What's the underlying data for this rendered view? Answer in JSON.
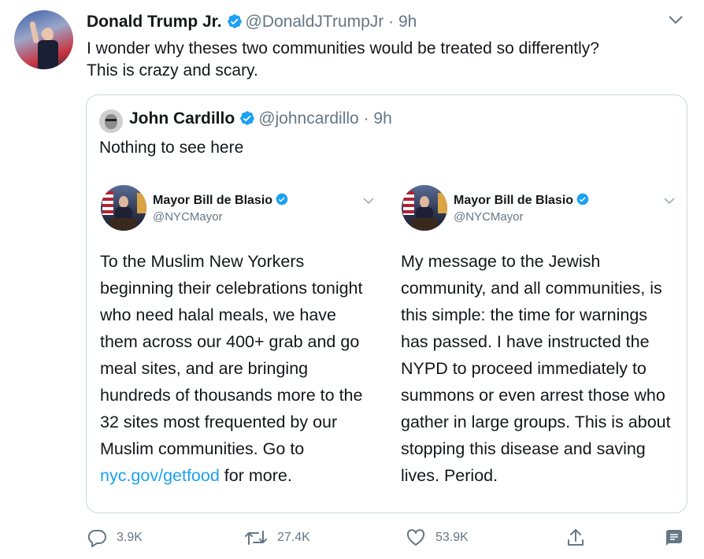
{
  "tweet": {
    "author_name": "Donald Trump Jr.",
    "author_handle": "@DonaldJTrumpJr",
    "separator": " · ",
    "time": "9h",
    "text": "I wonder why theses two communities would be treated so differently?\nThis is crazy and scary."
  },
  "quote": {
    "author_name": "John Cardillo",
    "author_handle": "@johncardillo",
    "separator": " · ",
    "time": "9h",
    "text": "Nothing to see here"
  },
  "embedded": [
    {
      "name": "Mayor Bill de Blasio",
      "handle": "@NYCMayor",
      "text_before_link": "To the Muslim New Yorkers beginning their celebrations tonight who need halal meals, we have them across our 400+ grab and go meal sites, and are bringing hundreds of thousands more to the 32 sites most frequented by our Muslim communities. Go to ",
      "link": "nyc.gov/getfood",
      "text_after_link": " for more."
    },
    {
      "name": "Mayor Bill de Blasio",
      "handle": "@NYCMayor",
      "text": "My message to the Jewish community, and all communities, is this simple: the time for warnings has passed. I have instructed the NYPD to proceed immediately to summons or even arrest those who gather in large groups. This is about stopping this disease and saving lives. Period."
    }
  ],
  "actions": {
    "replies": "3.9K",
    "retweets": "27.4K",
    "likes": "53.9K"
  },
  "colors": {
    "verified": "#1da1f2",
    "link": "#1da1f2",
    "muted": "#657786",
    "border": "#ccd6dd"
  },
  "icons": [
    "verified-icon",
    "chevron-down-icon",
    "reply-icon",
    "retweet-icon",
    "like-icon",
    "share-icon",
    "analytics-icon"
  ]
}
